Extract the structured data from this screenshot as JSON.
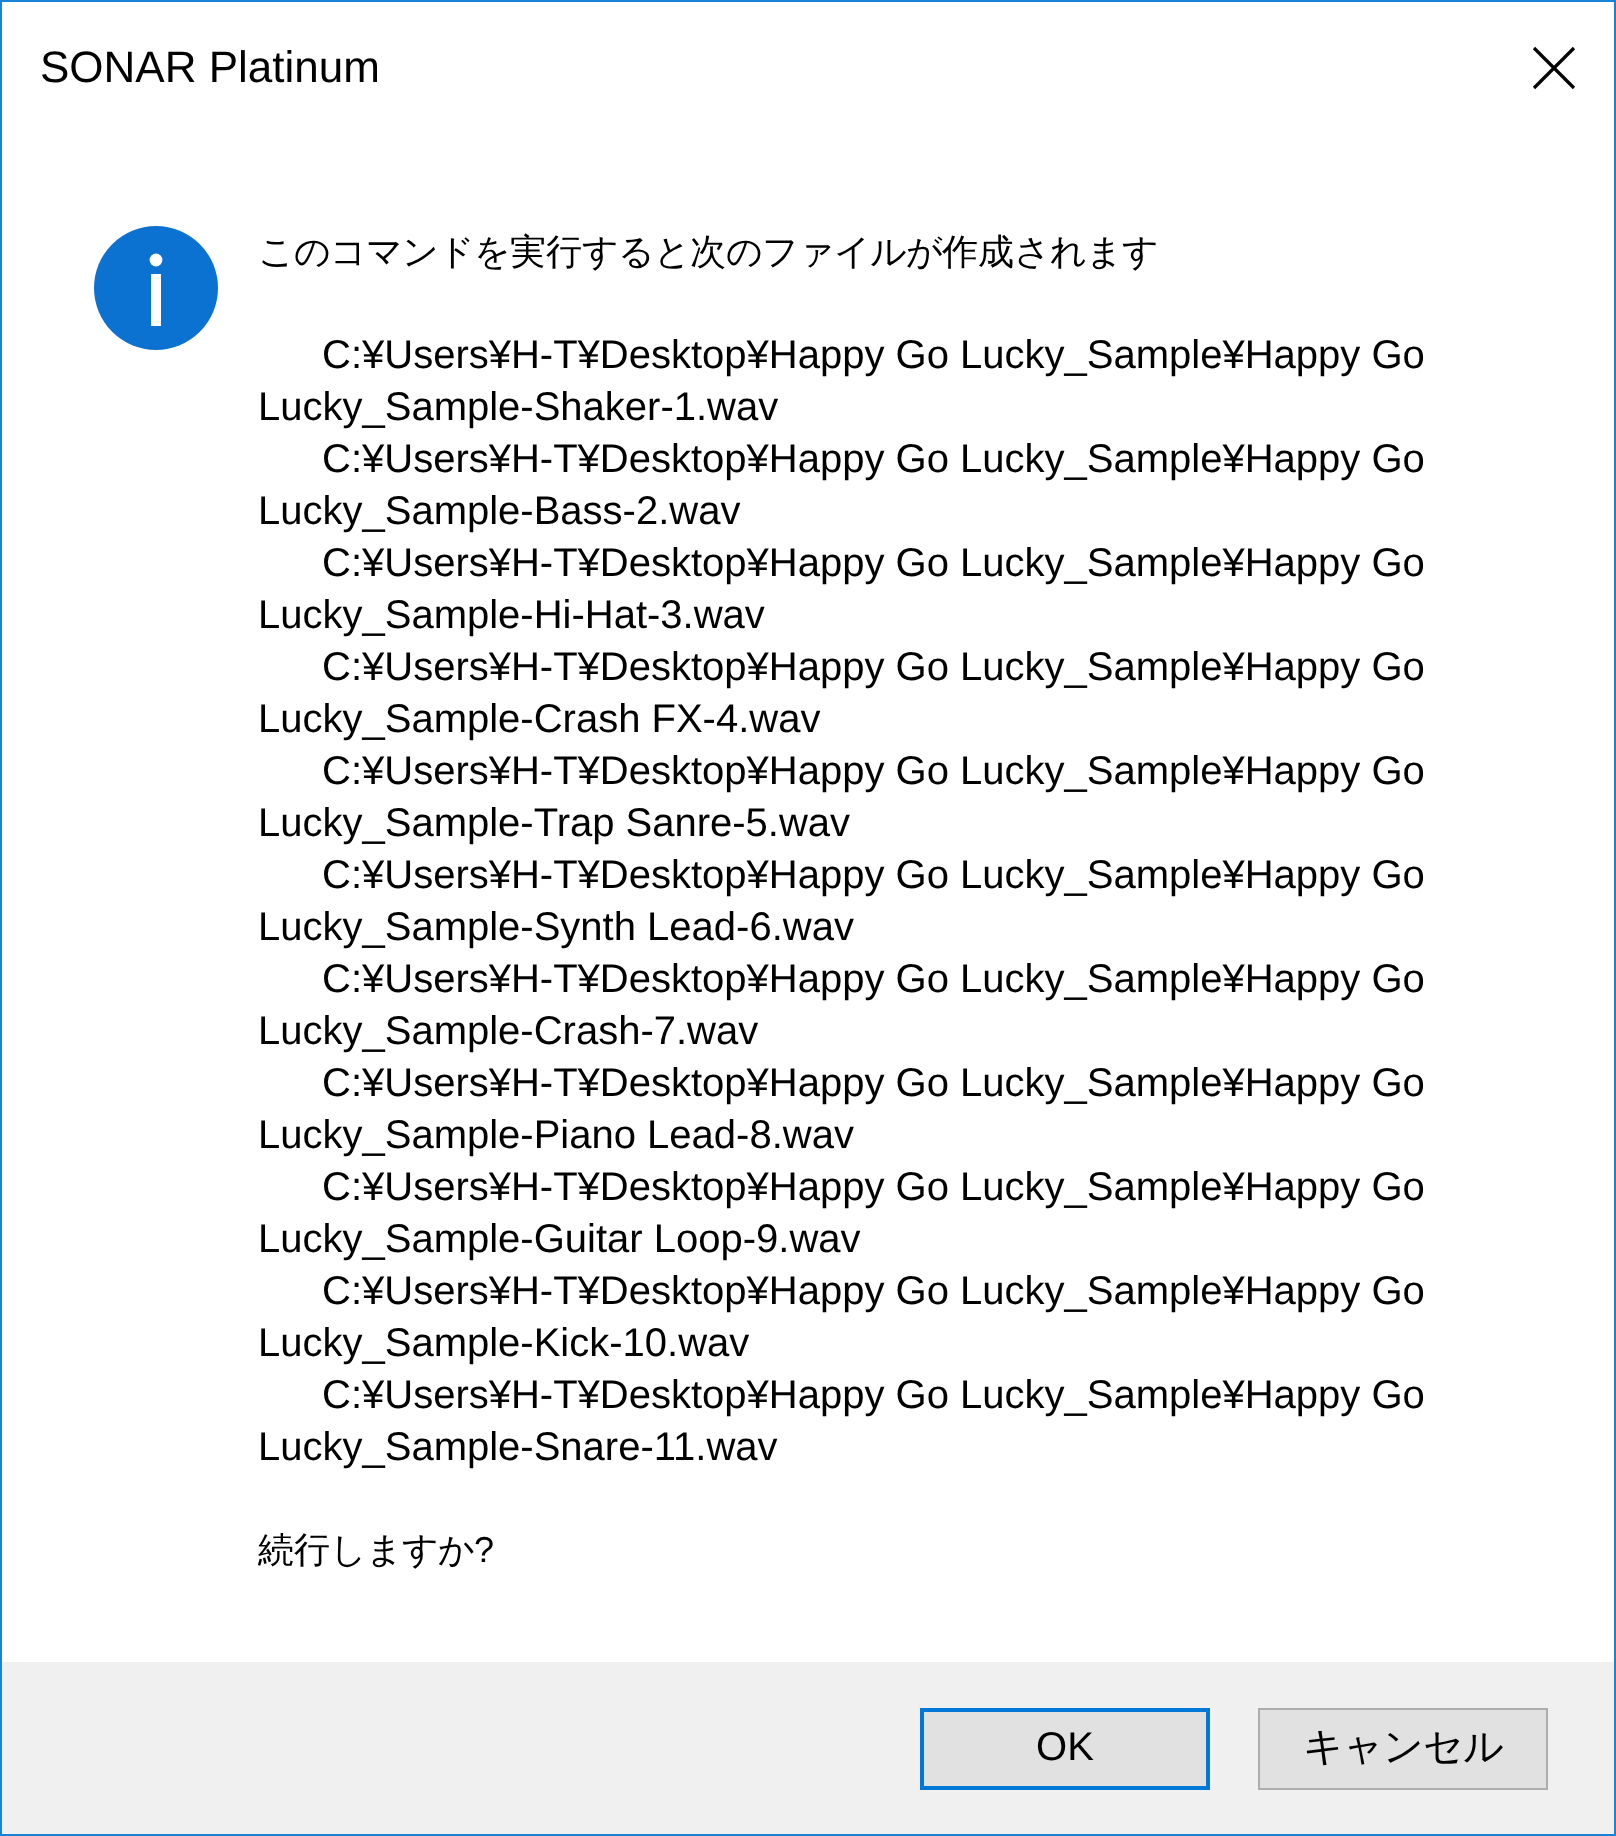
{
  "window": {
    "title": "SONAR Platinum"
  },
  "message": {
    "heading": "このコマンドを実行すると次のファイルが作成されます",
    "files": [
      "C:¥Users¥H-T¥Desktop¥Happy Go Lucky_Sample¥Happy Go Lucky_Sample-Shaker-1.wav",
      "C:¥Users¥H-T¥Desktop¥Happy Go Lucky_Sample¥Happy Go Lucky_Sample-Bass-2.wav",
      "C:¥Users¥H-T¥Desktop¥Happy Go Lucky_Sample¥Happy Go Lucky_Sample-Hi-Hat-3.wav",
      "C:¥Users¥H-T¥Desktop¥Happy Go Lucky_Sample¥Happy Go Lucky_Sample-Crash FX-4.wav",
      "C:¥Users¥H-T¥Desktop¥Happy Go Lucky_Sample¥Happy Go Lucky_Sample-Trap Sanre-5.wav",
      "C:¥Users¥H-T¥Desktop¥Happy Go Lucky_Sample¥Happy Go Lucky_Sample-Synth Lead-6.wav",
      "C:¥Users¥H-T¥Desktop¥Happy Go Lucky_Sample¥Happy Go Lucky_Sample-Crash-7.wav",
      "C:¥Users¥H-T¥Desktop¥Happy Go Lucky_Sample¥Happy Go Lucky_Sample-Piano Lead-8.wav",
      "C:¥Users¥H-T¥Desktop¥Happy Go Lucky_Sample¥Happy Go Lucky_Sample-Guitar Loop-9.wav",
      "C:¥Users¥H-T¥Desktop¥Happy Go Lucky_Sample¥Happy Go Lucky_Sample-Kick-10.wav",
      "C:¥Users¥H-T¥Desktop¥Happy Go Lucky_Sample¥Happy Go Lucky_Sample-Snare-11.wav"
    ],
    "question": "続行しますか?"
  },
  "buttons": [
    {
      "label": "OK",
      "default": true
    },
    {
      "label": "キャンセル",
      "default": false
    }
  ]
}
